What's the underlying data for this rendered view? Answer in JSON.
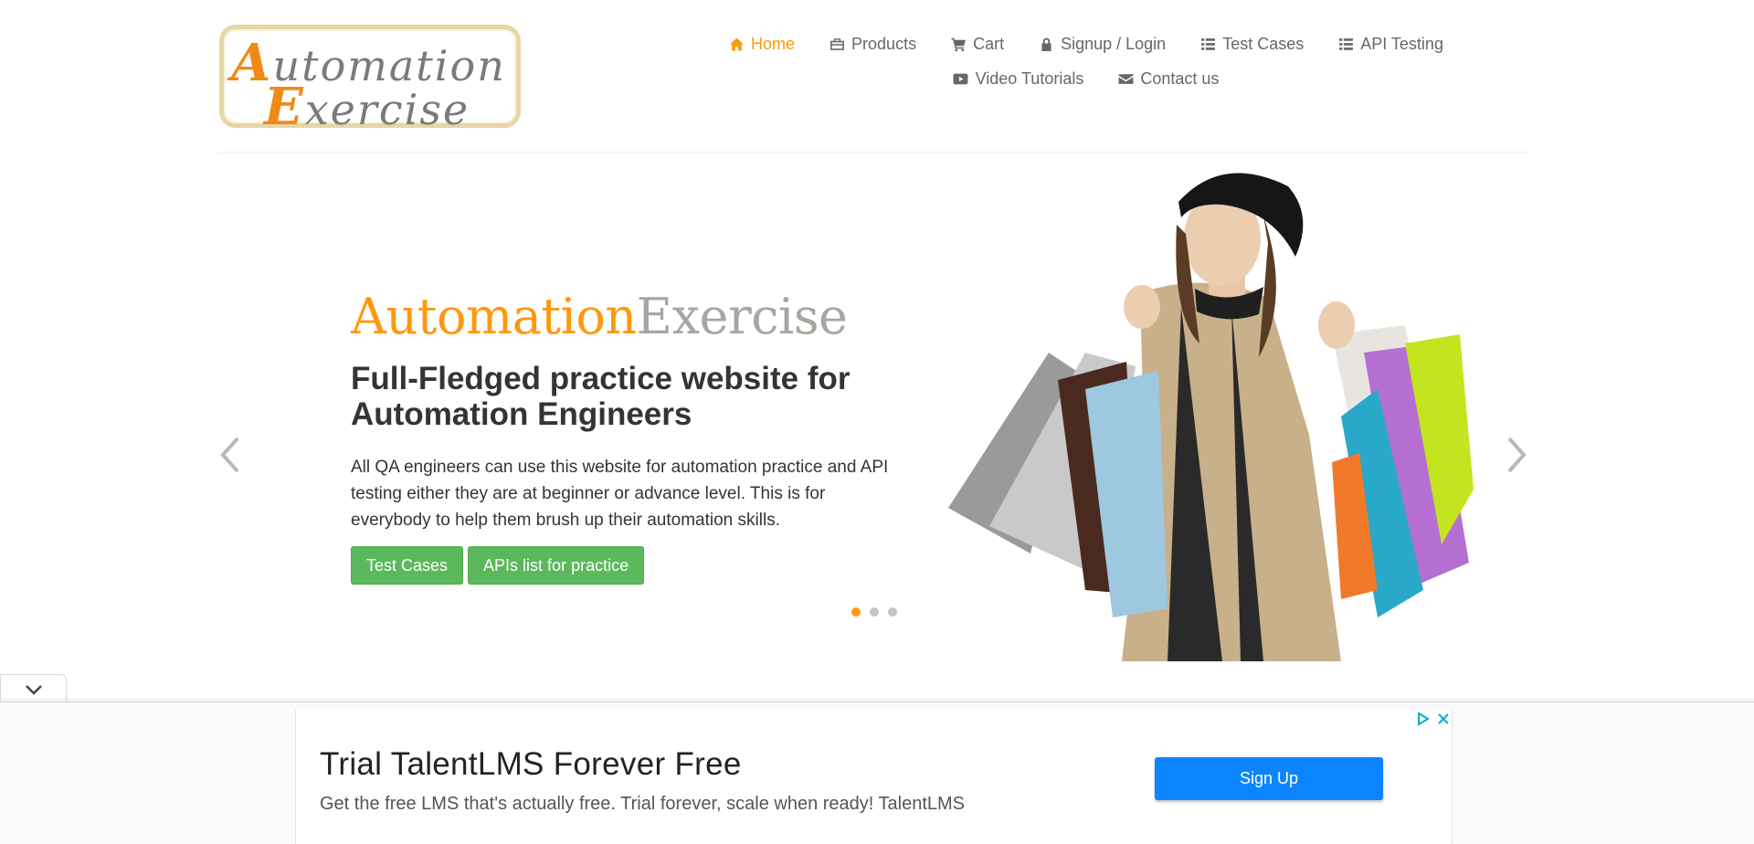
{
  "logo": {
    "line1_cap": "A",
    "line1_rest": "utomation",
    "line2_cap": "E",
    "line2_rest": "xercise"
  },
  "nav": {
    "row1": [
      {
        "label": "Home",
        "icon": "home-icon",
        "active": true
      },
      {
        "label": "Products",
        "icon": "briefcase-icon"
      },
      {
        "label": "Cart",
        "icon": "cart-icon"
      },
      {
        "label": "Signup / Login",
        "icon": "lock-icon"
      },
      {
        "label": "Test Cases",
        "icon": "list-icon"
      },
      {
        "label": "API Testing",
        "icon": "list-icon"
      }
    ],
    "row2": [
      {
        "label": "Video Tutorials",
        "icon": "youtube-play-icon"
      },
      {
        "label": "Contact us",
        "icon": "envelope-icon"
      }
    ]
  },
  "hero": {
    "brand_part1": "Automation",
    "brand_part2": "Exercise",
    "title": "Full-Fledged practice website for Automation Engineers",
    "description": "All QA engineers can use this website for automation practice and API testing either they are at beginner or advance level. This is for everybody to help them brush up their automation skills.",
    "btn_test_cases": "Test Cases",
    "btn_apis": "APIs list for practice",
    "slide_count": 3,
    "active_slide": 1,
    "image_subject": "woman-with-shopping-bags"
  },
  "ad": {
    "title": "Trial TalentLMS Forever Free",
    "description": "Get the free LMS that's actually free. Trial forever, scale when ready! TalentLMS",
    "cta": "Sign Up",
    "icons": [
      "adchoices-icon",
      "close-icon"
    ]
  },
  "colors": {
    "accent": "#FE980F",
    "button_green": "#5cb85c",
    "ad_button": "#0a84ff",
    "text": "#696763"
  }
}
